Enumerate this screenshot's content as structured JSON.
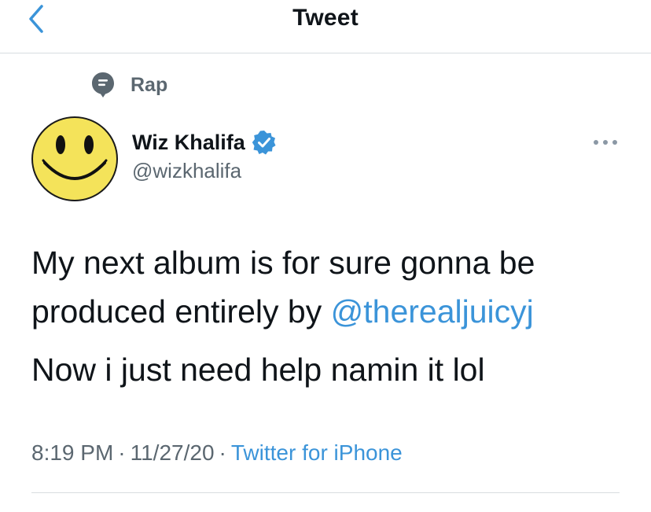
{
  "header": {
    "title": "Tweet",
    "back_icon": "chevron-left-icon"
  },
  "topic": {
    "label": "Rap",
    "icon": "topic-speech-bubble-icon"
  },
  "author": {
    "name": "Wiz Khalifa",
    "handle": "@wizkhalifa",
    "verified": true,
    "avatar": "smiley-face-avatar"
  },
  "tweet": {
    "line1_before_mention": "My next album is for sure gonna be produced entirely by ",
    "mention": "@therealjuicyj",
    "line2": "Now i just need help namin it lol"
  },
  "meta": {
    "time": "8:19 PM",
    "separator": "·",
    "date": "11/27/20",
    "source": "Twitter for iPhone"
  },
  "colors": {
    "accent": "#3b94d9",
    "text": "#0f1419",
    "secondary": "#5b6770",
    "divider": "#d8dde0"
  }
}
